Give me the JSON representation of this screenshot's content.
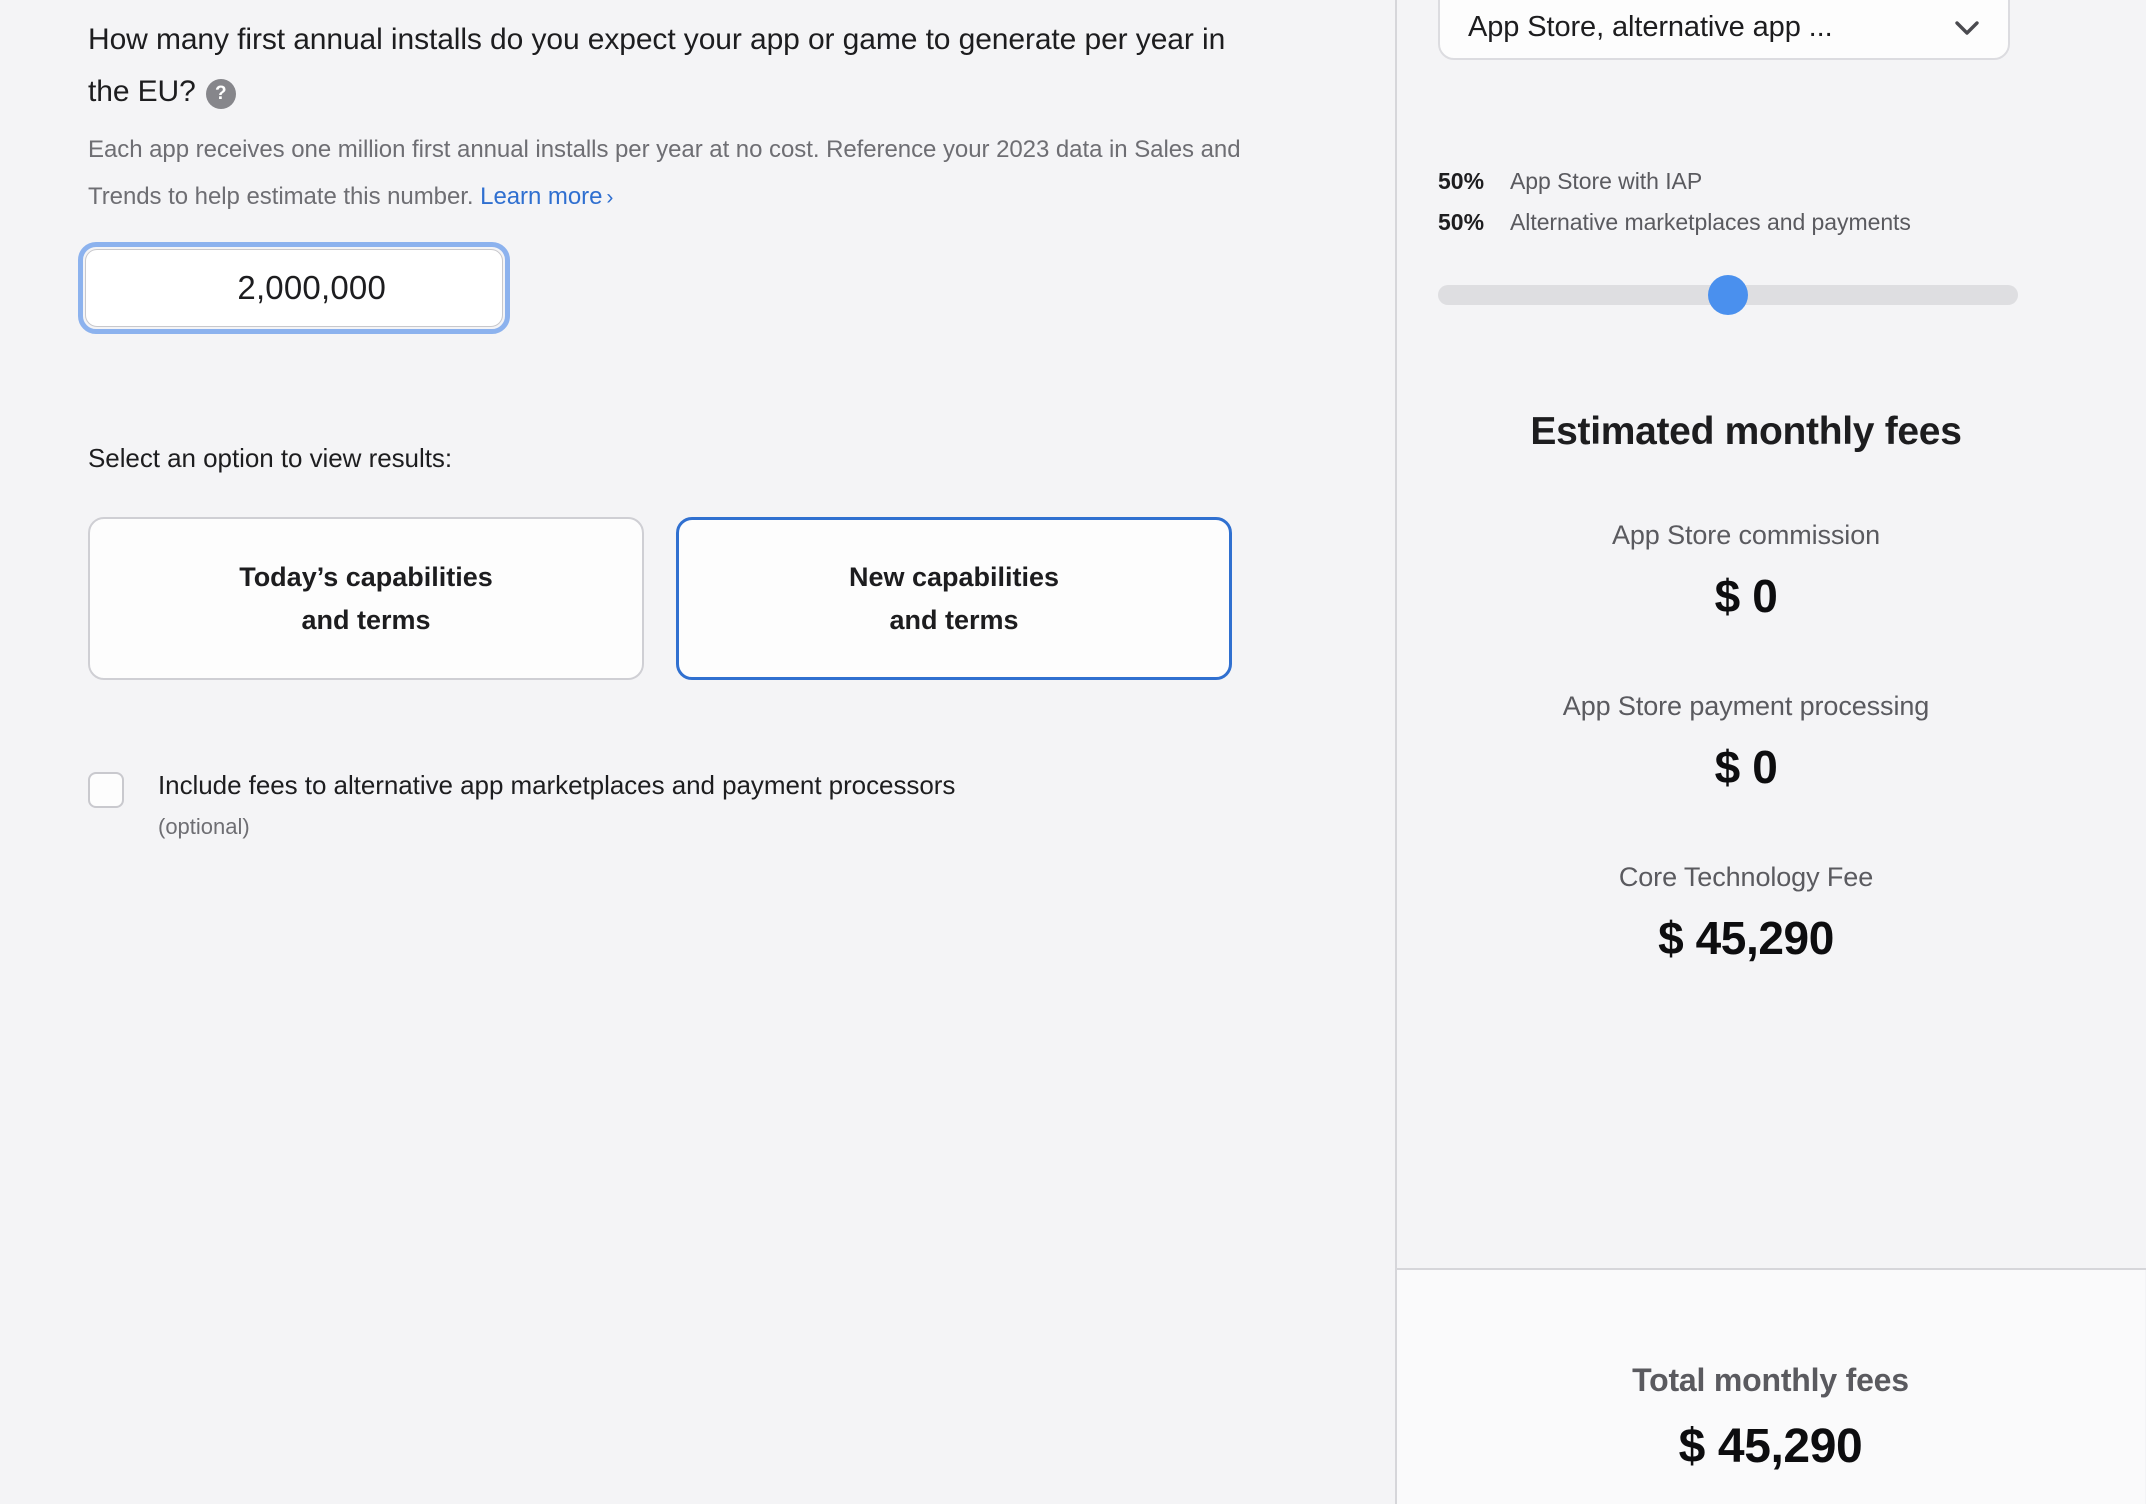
{
  "left": {
    "question": {
      "title_line1": "How many first annual installs do you expect your app or game to generate",
      "title_line2": "per year in the EU?",
      "help_icon": "help-circle-icon",
      "sub_text": "Each app receives one million first annual installs per year at no cost. Reference your 2023 data in Sales and Trends to help estimate this number.",
      "learn_more_label": "Learn more",
      "learn_more_chevron": "›"
    },
    "install_input": {
      "value": "2,000,000",
      "placeholder": "0"
    },
    "options": {
      "prompt": "Select an option to view results:",
      "buttons": [
        {
          "line1": "Today’s capabilities",
          "line2": "and terms",
          "selected": false
        },
        {
          "line1": "New capabilities",
          "line2": "and terms",
          "selected": true
        }
      ]
    },
    "checkbox": {
      "label": "Include fees to alternative app marketplaces and payment processors",
      "optional": "(optional)",
      "checked": false
    }
  },
  "right": {
    "store_select": {
      "value": "App Store, alternative app ...",
      "chevron_icon": "chevron-down-icon"
    },
    "split": {
      "rows": [
        {
          "pct": "50%",
          "name": "App Store with IAP"
        },
        {
          "pct": "50%",
          "name": "Alternative marketplaces and payments"
        }
      ],
      "slider_position_pct": 50
    },
    "fees_title": "Estimated monthly fees",
    "fees": [
      {
        "label": "App Store commission",
        "amount": "$ 0"
      },
      {
        "label": "App Store payment processing",
        "amount": "$ 0"
      },
      {
        "label": "Core Technology Fee",
        "amount": "$ 45,290"
      }
    ],
    "total": {
      "label": "Total monthly fees",
      "amount": "$ 45,290"
    }
  },
  "colors": {
    "accent_blue": "#3070d0",
    "link_blue": "#2f6fd0",
    "slider_blue": "#4a90ee",
    "focus_ring": "#8cb2ee",
    "page_bg": "#f4f4f6",
    "divider": "#d6d6da"
  }
}
